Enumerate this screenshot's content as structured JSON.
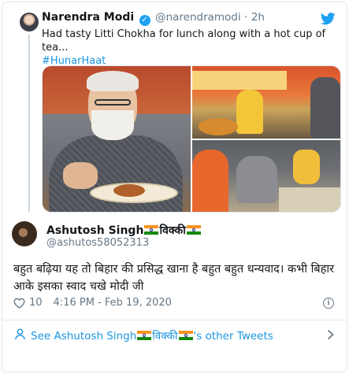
{
  "parent_tweet": {
    "author_name": "Narendra Modi",
    "handle": "@narendramodi",
    "separator": "·",
    "time": "2h",
    "text": "Had tasty Litti Chokha for lunch along with a hot cup of tea...",
    "hashtag": "#HunarHaat",
    "verified": true
  },
  "reply_tweet": {
    "author_name_prefix": "Ashutosh Singh",
    "author_name_middle": "विक्की",
    "handle": "@ashutos58052313",
    "text": "बहुत बढ़िया यह तो बिहार की प्रसिद्ध खाना है बहुत बहुत धन्यवाद। कभी बिहार आके इसका स्वाद चखे मोदी जी",
    "likes": "10",
    "timestamp": "4:16 PM - Feb 19, 2020"
  },
  "footer": {
    "prefix": "See Ashutosh Singh",
    "middle": "विक्की",
    "suffix": "'s other Tweets"
  },
  "colors": {
    "link": "#1b95e0",
    "secondary_text": "#657786",
    "border": "#e1e8ed",
    "verified": "#1da1f2"
  },
  "icons": [
    "twitter-bird-icon",
    "verified-badge-icon",
    "heart-icon",
    "info-icon",
    "user-icon",
    "chevron-right-icon",
    "india-flag-icon"
  ]
}
